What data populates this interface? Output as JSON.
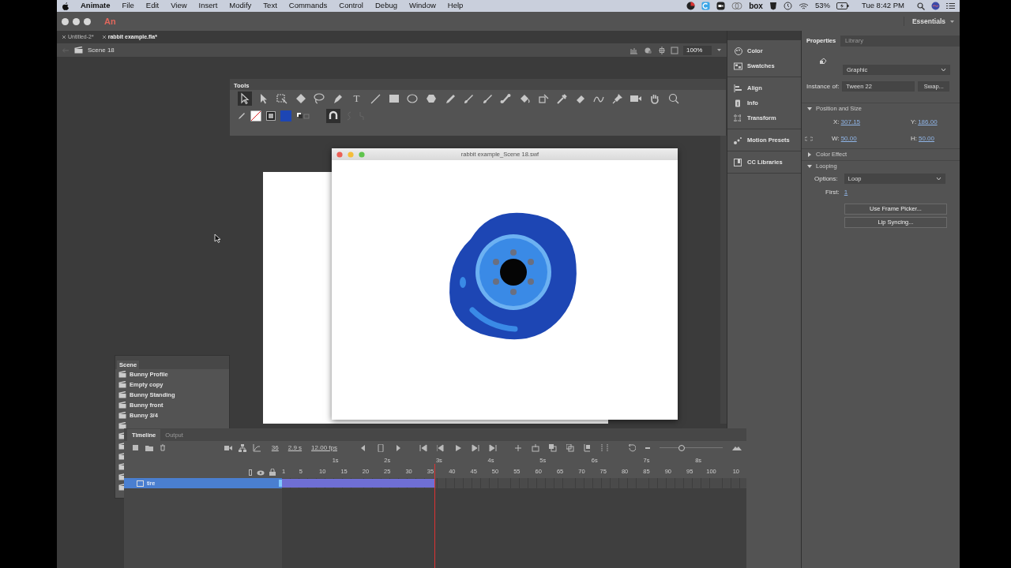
{
  "menubar": {
    "app": "Animate",
    "items": [
      "File",
      "Edit",
      "View",
      "Insert",
      "Modify",
      "Text",
      "Commands",
      "Control",
      "Debug",
      "Window",
      "Help"
    ],
    "tray_text": "box",
    "battery": "53%",
    "clock": "Tue 8:42 PM"
  },
  "titlebar": {
    "logo": "An",
    "workspace": "Essentials"
  },
  "doc_tabs": [
    {
      "label": "Untitled-2*",
      "selected": false
    },
    {
      "label": "rabbit example.fla*",
      "selected": true
    }
  ],
  "edit_bar": {
    "scene": "Scene 18",
    "zoom": "100%"
  },
  "tools_panel": {
    "title": "Tools",
    "text_tool": "T"
  },
  "swf_window": {
    "title": "rabbit example_Scene 18.swf"
  },
  "scene_panel": {
    "title": "Scene",
    "scenes": [
      "Bunny Profile",
      "Empty  copy",
      "Bunny Standing",
      "Bunny front",
      "Bunny 3/4"
    ]
  },
  "dock_panels": [
    {
      "label": "Color"
    },
    {
      "label": "Swatches"
    },
    {
      "label": "Align"
    },
    {
      "label": "Info"
    },
    {
      "label": "Transform"
    },
    {
      "label": "Motion Presets"
    },
    {
      "label": "CC Libraries"
    }
  ],
  "properties": {
    "tabs": [
      {
        "label": "Properties",
        "selected": true
      },
      {
        "label": "Library",
        "selected": false
      }
    ],
    "symbol_type": "Graphic",
    "instance_label": "Instance of:",
    "instance": "Tween 22",
    "swap": "Swap...",
    "position_size": {
      "title": "Position and Size",
      "expanded": true,
      "fields": [
        {
          "label": "X:",
          "value": "307.15"
        },
        {
          "label": "Y:",
          "value": "186.00"
        },
        {
          "label": "W:",
          "value": "50.00"
        },
        {
          "label": "H:",
          "value": "50.00"
        }
      ]
    },
    "color_effect": {
      "title": "Color Effect",
      "expanded": false
    },
    "looping": {
      "title": "Looping",
      "expanded": true,
      "options_label": "Options:",
      "option": "Loop",
      "first_label": "First:",
      "first": "1",
      "buttons": [
        "Use Frame Picker...",
        "Lip Syncing..."
      ]
    }
  },
  "timeline": {
    "tabs": [
      {
        "label": "Timeline",
        "selected": true
      },
      {
        "label": "Output",
        "selected": false
      }
    ],
    "current_frame": "36",
    "time": "2.9 s",
    "fps": "12.00 fps",
    "zoom_slider": {
      "level": 0.35
    },
    "seconds": [
      "1s",
      "2s",
      "3s",
      "4s",
      "5s",
      "6s",
      "7s",
      "8s"
    ],
    "frame_numbers": [
      "1",
      "5",
      "10",
      "15",
      "20",
      "25",
      "30",
      "35",
      "40",
      "45",
      "50",
      "55",
      "60",
      "65",
      "70",
      "75",
      "80",
      "85",
      "90",
      "95",
      "100",
      "10"
    ],
    "layers": [
      {
        "name": "tire",
        "selected": true
      }
    ]
  }
}
